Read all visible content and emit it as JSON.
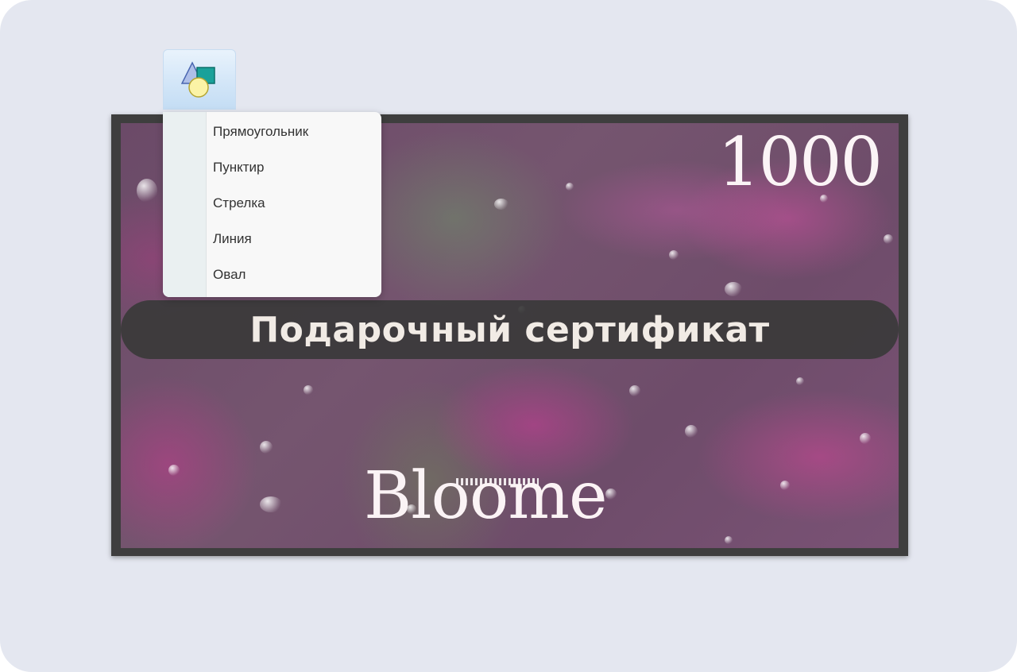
{
  "toolbar": {
    "shapes_button_icon": "shapes-icon"
  },
  "shapes_menu": {
    "items": [
      {
        "label": "Прямоугольник"
      },
      {
        "label": "Пунктир"
      },
      {
        "label": "Стрелка"
      },
      {
        "label": "Линия"
      },
      {
        "label": "Овал"
      }
    ]
  },
  "certificate": {
    "amount": "1000",
    "title": "Подарочный сертификат",
    "brand": "Bloome"
  },
  "colors": {
    "background": "#e4e7f0",
    "certificate_border": "#3e3e3e",
    "banner": "#3a3a3a",
    "text_light": "#fbf4f6"
  }
}
